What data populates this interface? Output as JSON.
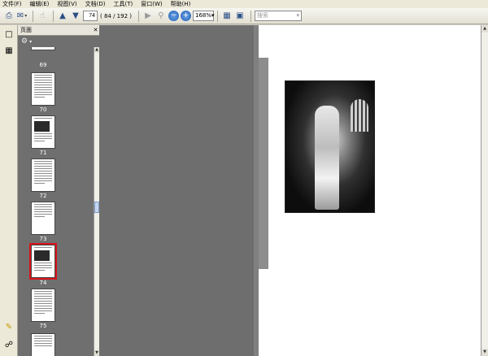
{
  "menubar": {
    "items": [
      "文件(F)",
      "编辑(E)",
      "视图(V)",
      "文档(D)",
      "工具(T)",
      "窗口(W)",
      "帮助(H)"
    ]
  },
  "toolbar": {
    "page_input": "74",
    "page_count": "( 84 / 192 )",
    "zoom_value": "168%",
    "find_placeholder": "搜索"
  },
  "icons": {
    "print": "printer-icon",
    "email": "email-icon",
    "prev": "up-arrow-icon",
    "next": "down-arrow-icon",
    "zoom_out": "minus-icon",
    "zoom_in": "plus-icon",
    "save": "floppy-icon",
    "fit": "fit-page-icon",
    "pages": "pages-icon",
    "bookmark": "bookmark-icon",
    "comment": "comment-icon",
    "attachment": "paperclip-icon"
  },
  "nav_pane": {
    "title": "页面",
    "thumb_labels": [
      "69",
      "70",
      "71",
      "72",
      "73",
      "74",
      "75"
    ],
    "current_index": 5
  },
  "document": {
    "caption": "",
    "edge_text": [],
    "right_column_lines": [
      "",
      "",
      "",
      "",
      "",
      "",
      "",
      "",
      "",
      "",
      "",
      "",
      "",
      "",
      ""
    ],
    "full_width_lines": [
      "",
      "",
      "",
      "",
      "",
      "",
      "",
      "",
      "",
      "",
      "",
      "",
      "",
      ""
    ]
  }
}
